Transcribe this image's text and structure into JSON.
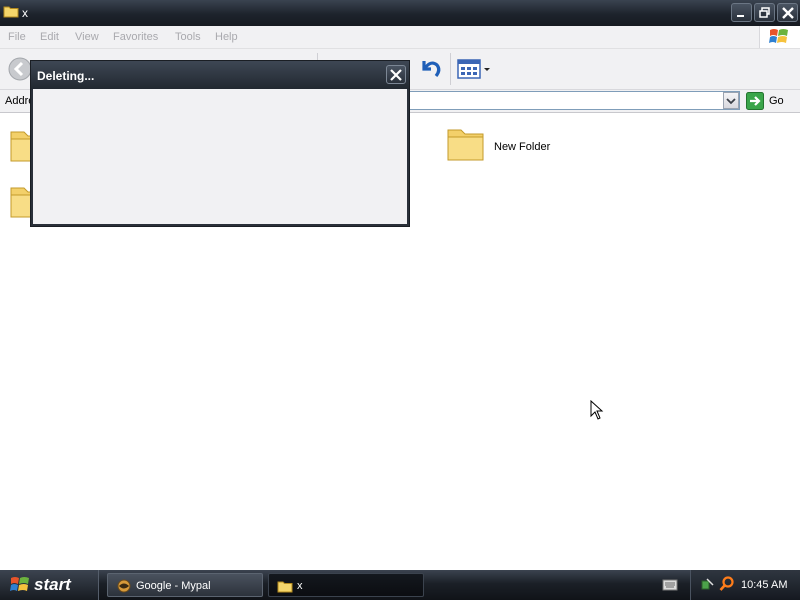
{
  "window": {
    "title": "x"
  },
  "menu": {
    "items": [
      "File",
      "Edit",
      "View",
      "Favorites",
      "Tools",
      "Help"
    ]
  },
  "address": {
    "label": "Addre",
    "go_label": "Go"
  },
  "content": {
    "items": [
      {
        "label": "New Folder"
      }
    ]
  },
  "dialog": {
    "title": "Deleting..."
  },
  "taskbar": {
    "start_label": "start",
    "tasks": [
      {
        "label": "Google - Mypal"
      },
      {
        "label": "x"
      }
    ],
    "clock": "10:45 AM"
  }
}
